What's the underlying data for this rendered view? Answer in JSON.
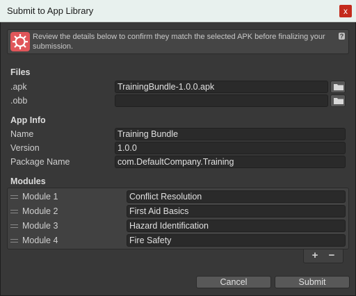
{
  "window": {
    "title": "Submit to App Library",
    "close_label": "x"
  },
  "info": {
    "text": "Review the details below to confirm they match the selected APK before finalizing your submission.",
    "help_label": "?"
  },
  "files": {
    "header": "Files",
    "apk_label": ".apk",
    "apk_value": "TrainingBundle-1.0.0.apk",
    "obb_label": ".obb",
    "obb_value": ""
  },
  "app_info": {
    "header": "App Info",
    "name_label": "Name",
    "name_value": "Training Bundle",
    "version_label": "Version",
    "version_value": "1.0.0",
    "package_label": "Package Name",
    "package_value": "com.DefaultCompany.Training"
  },
  "modules": {
    "header": "Modules",
    "items": [
      {
        "label": "Module 1",
        "value": "Conflict Resolution"
      },
      {
        "label": "Module 2",
        "value": "First Aid Basics"
      },
      {
        "label": "Module 3",
        "value": "Hazard Identification"
      },
      {
        "label": "Module 4",
        "value": "Fire Safety"
      }
    ],
    "add_label": "+",
    "remove_label": "−"
  },
  "buttons": {
    "cancel": "Cancel",
    "submit": "Submit"
  }
}
